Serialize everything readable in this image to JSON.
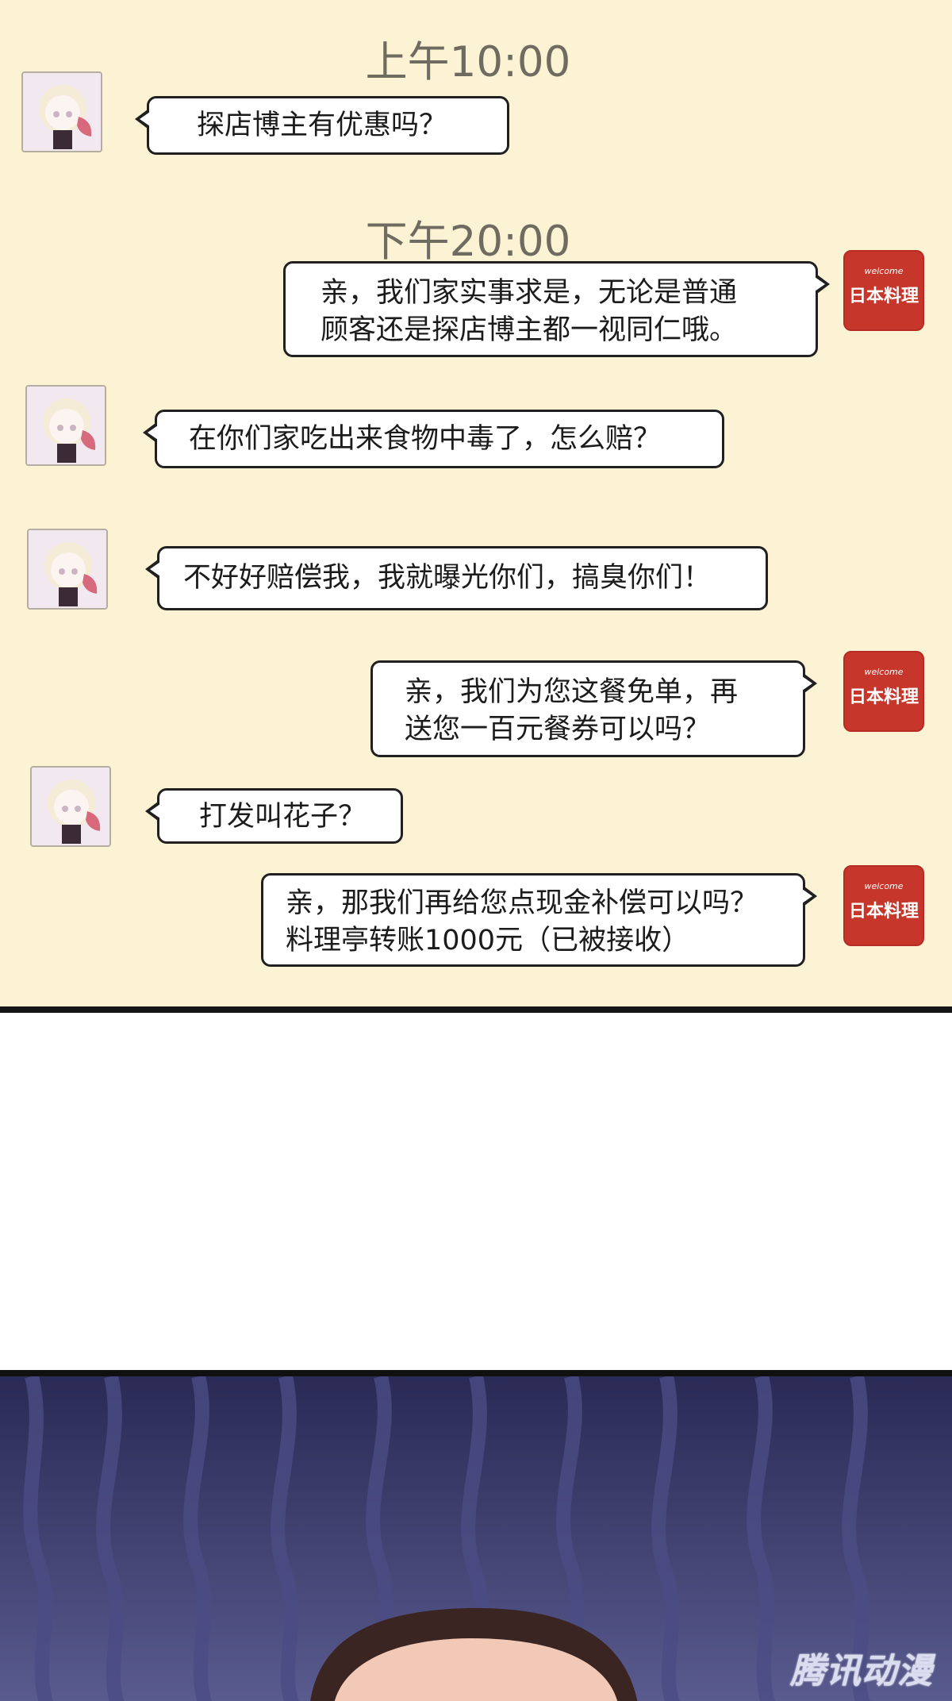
{
  "chat": {
    "time_morning": "上午10:00",
    "time_evening": "下午20:00",
    "messages": [
      {
        "text": "探店博主有优惠吗？"
      },
      {
        "text": "亲，我们家实事求是，无论是普通\n顾客还是探店博主都一视同仁哦。"
      },
      {
        "text": "在你们家吃出来食物中毒了，怎么赔？"
      },
      {
        "text": "不好好赔偿我，我就曝光你们，搞臭你们！"
      },
      {
        "text": "亲，我们为您这餐免单，再\n送您一百元餐券可以吗？"
      },
      {
        "text": "打发叫花子？"
      },
      {
        "text": "亲，那我们再给您点现金补偿可以吗？\n料理亭转账1000元（已被接收）"
      }
    ],
    "shop_logo": {
      "top_text": "welcome",
      "main_text": "日本料理"
    }
  },
  "scene": {
    "watermark": "腾讯动漫"
  },
  "colors": {
    "chat_bg": "#fbf3d4",
    "shop_red": "#c7362b",
    "scene_bg": "#2d2c58"
  }
}
